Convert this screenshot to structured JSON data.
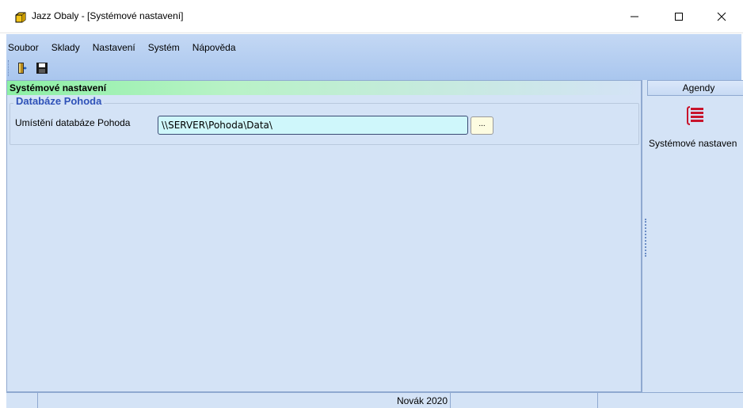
{
  "window": {
    "title": "Jazz Obaly - [Systémové nastavení]",
    "app_icon": "cube-icon",
    "controls": [
      "minimize",
      "maximize",
      "close"
    ]
  },
  "menubar": {
    "items": [
      {
        "label": "Soubor"
      },
      {
        "label": "Sklady"
      },
      {
        "label": "Nastavení"
      },
      {
        "label": "Systém"
      },
      {
        "label": "Nápověda"
      }
    ]
  },
  "toolbar": {
    "buttons": [
      {
        "icon": "exit-door-icon"
      },
      {
        "icon": "save-floppy-icon"
      }
    ]
  },
  "main": {
    "section_title": "Systémové nastavení",
    "group_title": "Databáze Pohoda",
    "field_label": "Umístění databáze Pohoda",
    "field_value": "\\\\SERVER\\Pohoda\\Data\\",
    "browse_label": "..."
  },
  "agendy": {
    "header": "Agendy",
    "items": [
      {
        "label": "Systémové nastaven",
        "icon": "settings-list-icon"
      }
    ]
  },
  "statusbar": {
    "user": "Novák 2020"
  },
  "colors": {
    "panel_bg": "#d4e3f6",
    "header_green": "#8cf0a4",
    "group_title_blue": "#2f52b8",
    "input_bg": "#cff7fb"
  }
}
